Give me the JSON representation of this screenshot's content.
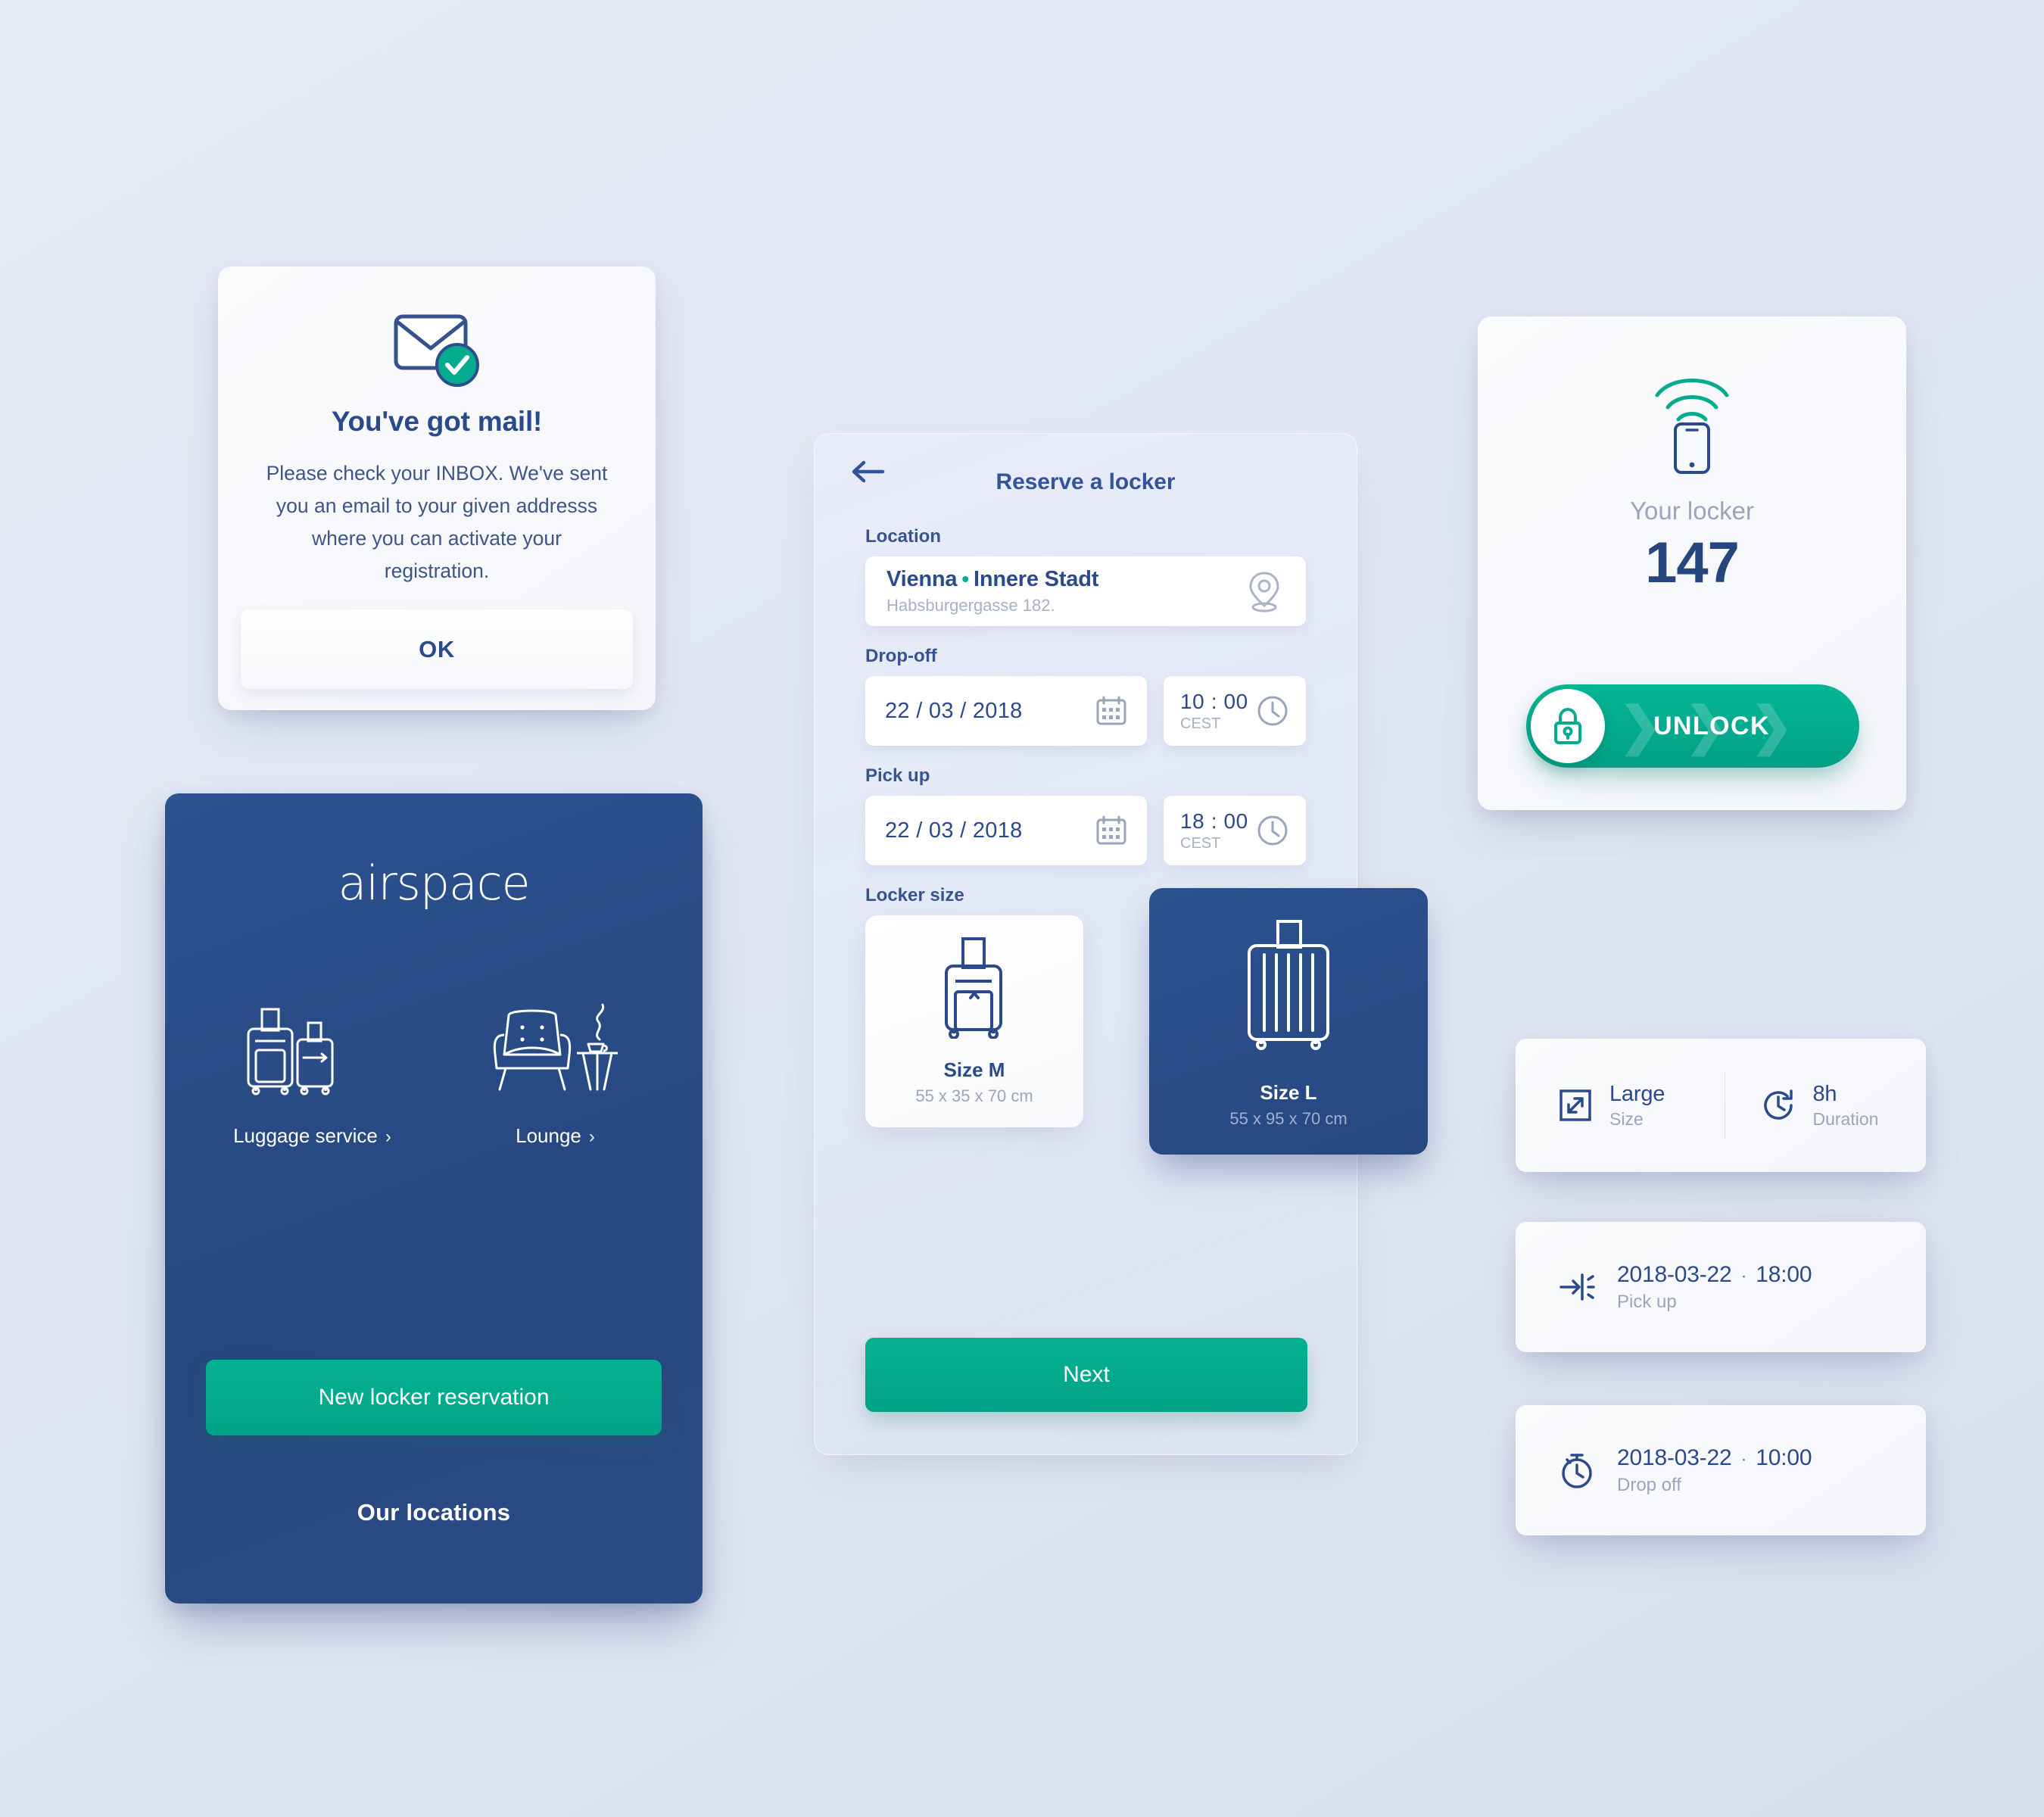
{
  "colors": {
    "brand_blue": "#2b4a8b",
    "card_blue": "#2a4a84",
    "accent_green": "#05ab8f",
    "muted_text": "#9aa5bd",
    "background": "#e3e8f3"
  },
  "mail_dialog": {
    "icon": "envelope-check-icon",
    "title": "You've got mail!",
    "body": "Please check your INBOX. We've sent you an email to your given addresss where you can activate your registration.",
    "ok_label": "OK"
  },
  "airspace_card": {
    "logo": "airspace",
    "services": [
      {
        "icon": "luggage-icon",
        "label": "Luggage service",
        "chevron": "›"
      },
      {
        "icon": "lounge-chair-icon",
        "label": "Lounge",
        "chevron": "›"
      }
    ],
    "primary_button": "New locker reservation",
    "secondary_link": "Our locations"
  },
  "reserve_panel": {
    "back_icon": "back-arrow-icon",
    "title": "Reserve a locker",
    "location": {
      "label": "Location",
      "city": "Vienna",
      "separator": "•",
      "district": "Innere Stadt",
      "address": "Habsburgergasse 182.",
      "icon": "map-pin-icon"
    },
    "dropoff": {
      "label": "Drop-off",
      "date": "22 / 03 / 2018",
      "date_icon": "calendar-icon",
      "time": "10 : 00",
      "timezone": "CEST",
      "time_icon": "clock-icon"
    },
    "pickup": {
      "label": "Pick up",
      "date": "22 / 03 / 2018",
      "date_icon": "calendar-icon",
      "time": "18 : 00",
      "timezone": "CEST",
      "time_icon": "clock-icon"
    },
    "locker_size": {
      "label": "Locker size",
      "options": [
        {
          "name": "Size M",
          "dims": "55 x 35 x 70 cm",
          "icon": "suitcase-medium-icon",
          "selected": false
        },
        {
          "name": "Size L",
          "dims": "55 x 95 x 70 cm",
          "icon": "suitcase-large-icon",
          "selected": true
        }
      ]
    },
    "next_label": "Next"
  },
  "locker_card": {
    "icon": "phone-wifi-icon",
    "label": "Your locker",
    "number": "147",
    "unlock_label": "UNLOCK",
    "lock_icon": "lock-icon",
    "chevrons": "❯"
  },
  "summary": {
    "size": {
      "icon": "expand-arrows-icon",
      "value": "Large",
      "label": "Size"
    },
    "duration": {
      "icon": "clock-duration-icon",
      "value": "8h",
      "label": "Duration"
    },
    "pickup": {
      "icon": "arrow-to-line-icon",
      "date": "2018-03-22",
      "separator": "·",
      "time": "18:00",
      "label": "Pick up"
    },
    "dropoff": {
      "icon": "stopwatch-icon",
      "date": "2018-03-22",
      "separator": "·",
      "time": "10:00",
      "label": "Drop off"
    }
  }
}
